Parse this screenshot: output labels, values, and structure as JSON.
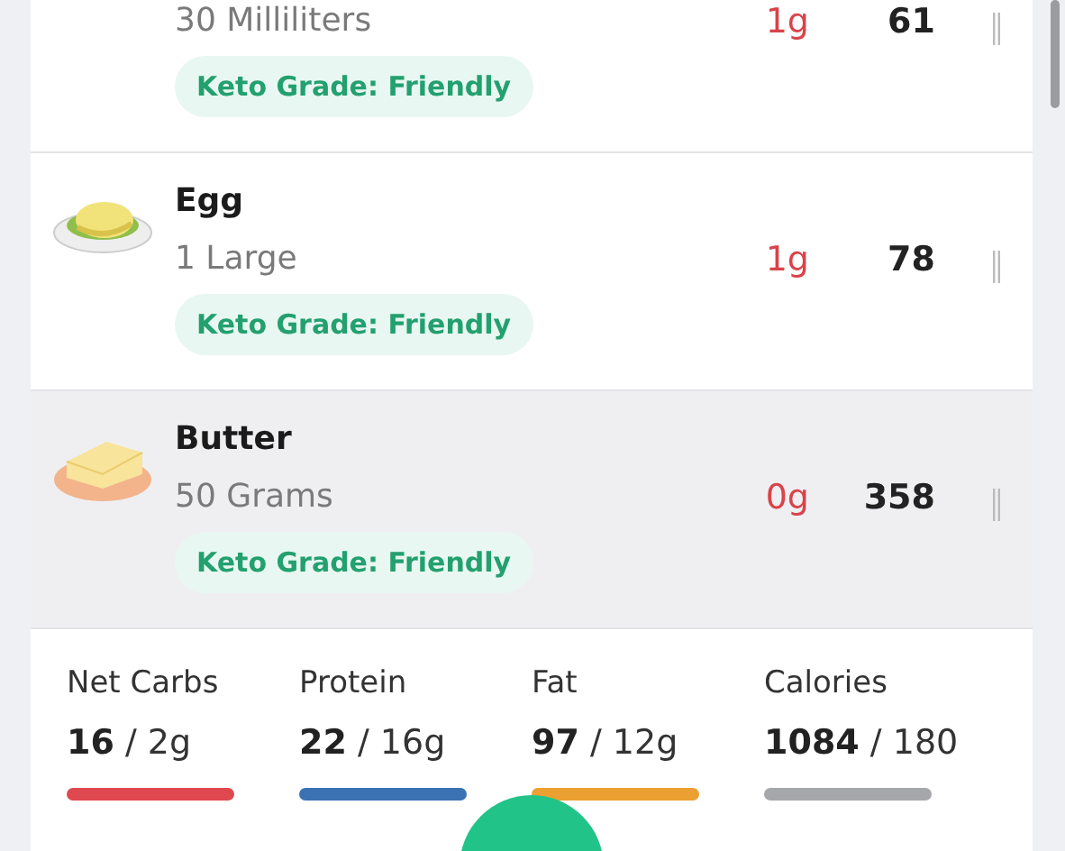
{
  "foods": [
    {
      "portion": "30 Milliliters",
      "net_carbs": "1g",
      "calories": "61",
      "badge": "Keto Grade: Friendly",
      "selected": false
    },
    {
      "name": "Egg",
      "portion": "1 Large",
      "net_carbs": "1g",
      "calories": "78",
      "badge": "Keto Grade: Friendly",
      "selected": false
    },
    {
      "name": "Butter",
      "portion": "50 Grams",
      "net_carbs": "0g",
      "calories": "358",
      "badge": "Keto Grade: Friendly",
      "selected": true
    }
  ],
  "summary": [
    {
      "label": "Net Carbs",
      "value": "**16** / 2g",
      "color": "#e0484f"
    },
    {
      "label": "Protein",
      "value": "**22** / 16g",
      "color": "#3a72b3"
    },
    {
      "label": "Fat",
      "value": "**97** / 12g",
      "color": "#eba032"
    },
    {
      "label": "Calories",
      "value": "**1084** / 180",
      "color": "#a5a7ab"
    }
  ]
}
